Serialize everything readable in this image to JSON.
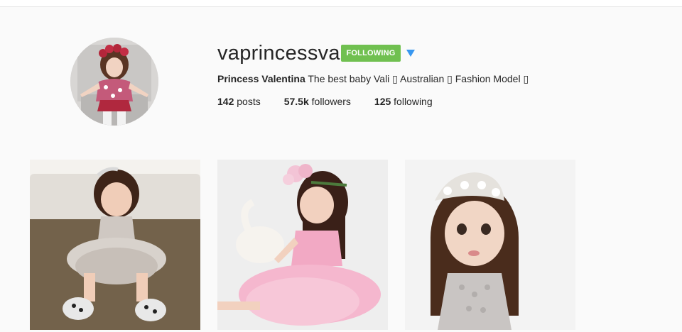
{
  "profile": {
    "username": "vaprincessva",
    "follow_button_label": "FOLLOWING",
    "bio_name": "Princess Valentina",
    "bio_text": " The best baby Vali ▯ Australian ▯ Fashion Model ▯",
    "stats": {
      "posts_count": "142",
      "posts_label": " posts",
      "followers_count": "57.5k",
      "followers_label": " followers",
      "following_count": "125",
      "following_label": " following"
    }
  },
  "colors": {
    "follow_button": "#70c050",
    "dropdown_arrow": "#3897f0",
    "background": "#fafafa"
  },
  "icons": {
    "dropdown": "chevron-down-icon"
  },
  "posts": [
    {
      "kind": "photo"
    },
    {
      "kind": "photo"
    },
    {
      "kind": "photo"
    }
  ]
}
